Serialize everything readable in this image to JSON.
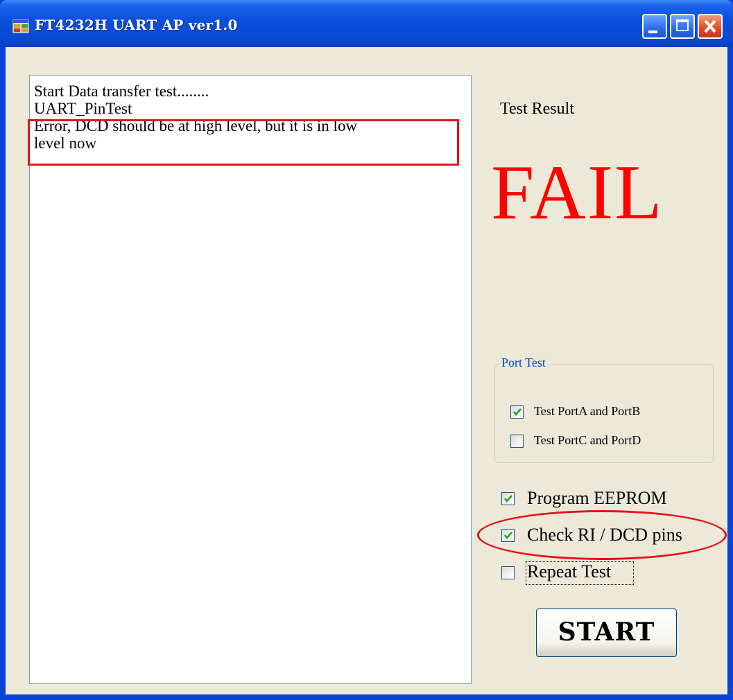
{
  "window": {
    "title": "FT4232H UART AP ver1.0",
    "icon": "app-window-icon",
    "controls": [
      "minimize-icon",
      "maximize-icon",
      "close-icon"
    ]
  },
  "log": {
    "lines": [
      "Start Data transfer test........",
      "UART_PinTest",
      "Error, DCD should be at high level, but it is in low",
      "level now"
    ]
  },
  "result": {
    "label": "Test Result",
    "status": "FAIL",
    "status_color": "#ff0000"
  },
  "port_test": {
    "title": "Port Test",
    "options": [
      {
        "label": "Test PortA and PortB",
        "checked": true
      },
      {
        "label": "Test PortC and PortD",
        "checked": false
      }
    ]
  },
  "options": [
    {
      "label": "Program EEPROM",
      "checked": true
    },
    {
      "label": "Check RI / DCD pins",
      "checked": true
    },
    {
      "label": "Repeat Test",
      "checked": false
    }
  ],
  "start_button": {
    "label": "START"
  },
  "colors": {
    "titlebar": "#0a4fdc",
    "client_bg": "#ece9d8",
    "annotation_red": "#e6121c",
    "group_title": "#0046d5"
  }
}
